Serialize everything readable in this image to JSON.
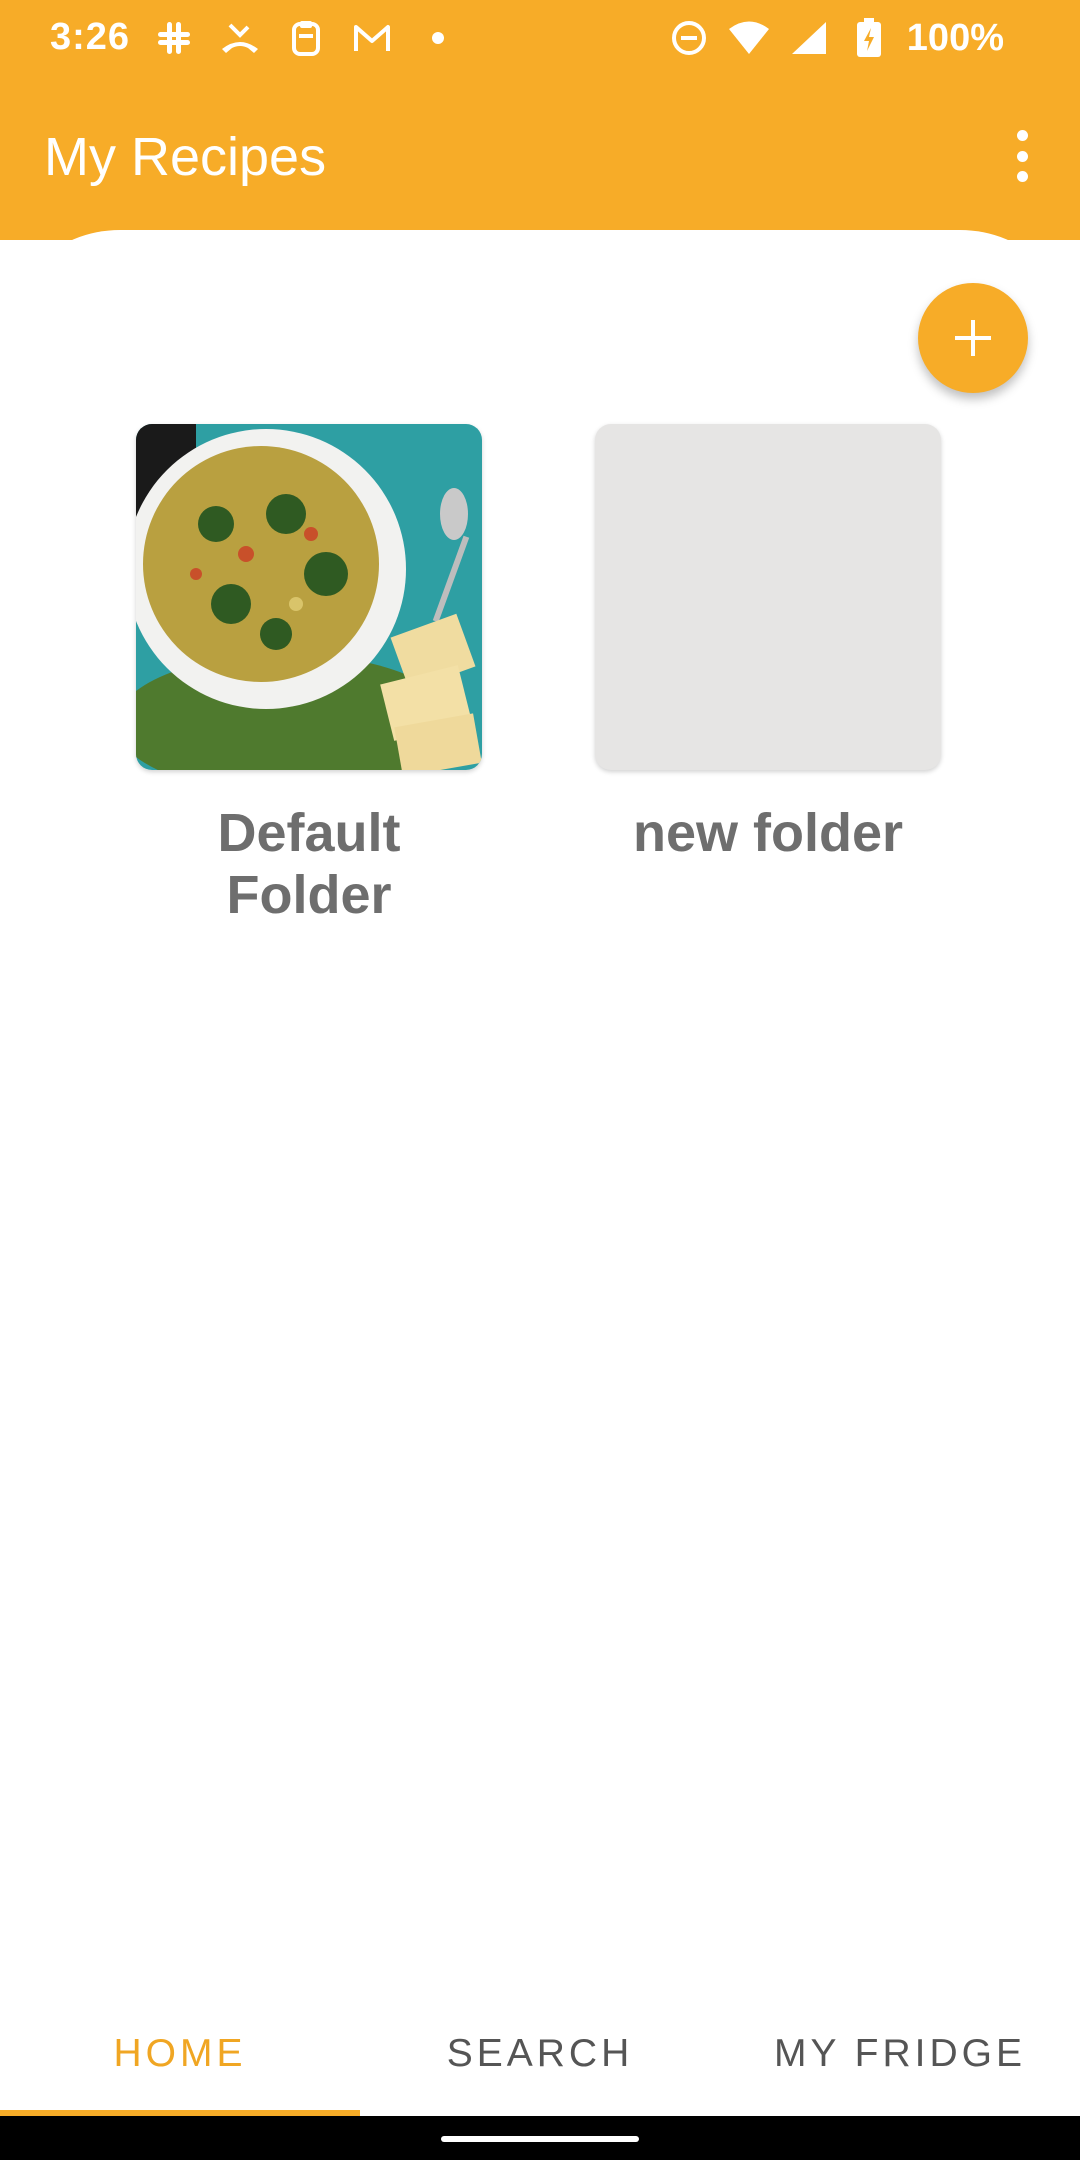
{
  "status_bar": {
    "time": "3:26",
    "battery": "100%",
    "left_icons": [
      "slack-icon",
      "missed-call-icon",
      "clipboard-icon",
      "gmail-icon",
      "dot-icon"
    ],
    "right_icons": [
      "do-not-disturb-icon",
      "wifi-icon",
      "signal-icon",
      "battery-charging-icon"
    ]
  },
  "app_bar": {
    "title": "My Recipes",
    "menu_icon": "more-vert-icon"
  },
  "fab": {
    "icon": "plus-icon"
  },
  "folders": [
    {
      "label": "Default Folder",
      "has_image": true
    },
    {
      "label": "new folder",
      "has_image": false
    }
  ],
  "tabs": [
    {
      "label": "HOME",
      "selected": true
    },
    {
      "label": "SEARCH",
      "selected": false
    },
    {
      "label": "MY FRIDGE",
      "selected": false
    }
  ],
  "colors": {
    "accent": "#F7AC28",
    "selected_tab": "#F0A623",
    "text_gray": "#6E6E6E",
    "placeholder": "#E6E5E4"
  }
}
